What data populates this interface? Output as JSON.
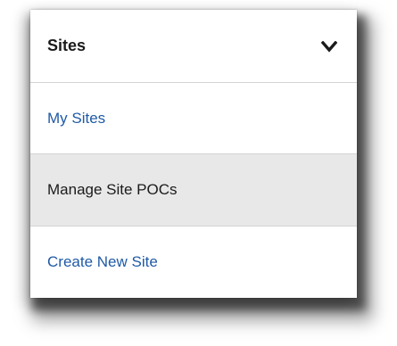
{
  "menu": {
    "title": "Sites",
    "toggle_icon": "chevron-down-icon",
    "items": [
      {
        "label": "My Sites"
      },
      {
        "label": "Manage Site POCs"
      },
      {
        "label": "Create New Site"
      }
    ]
  },
  "colors": {
    "link": "#1f5aa6",
    "text": "#1b1b1b",
    "selected_bg": "#e8e8e8",
    "divider": "#d4d4d4"
  }
}
